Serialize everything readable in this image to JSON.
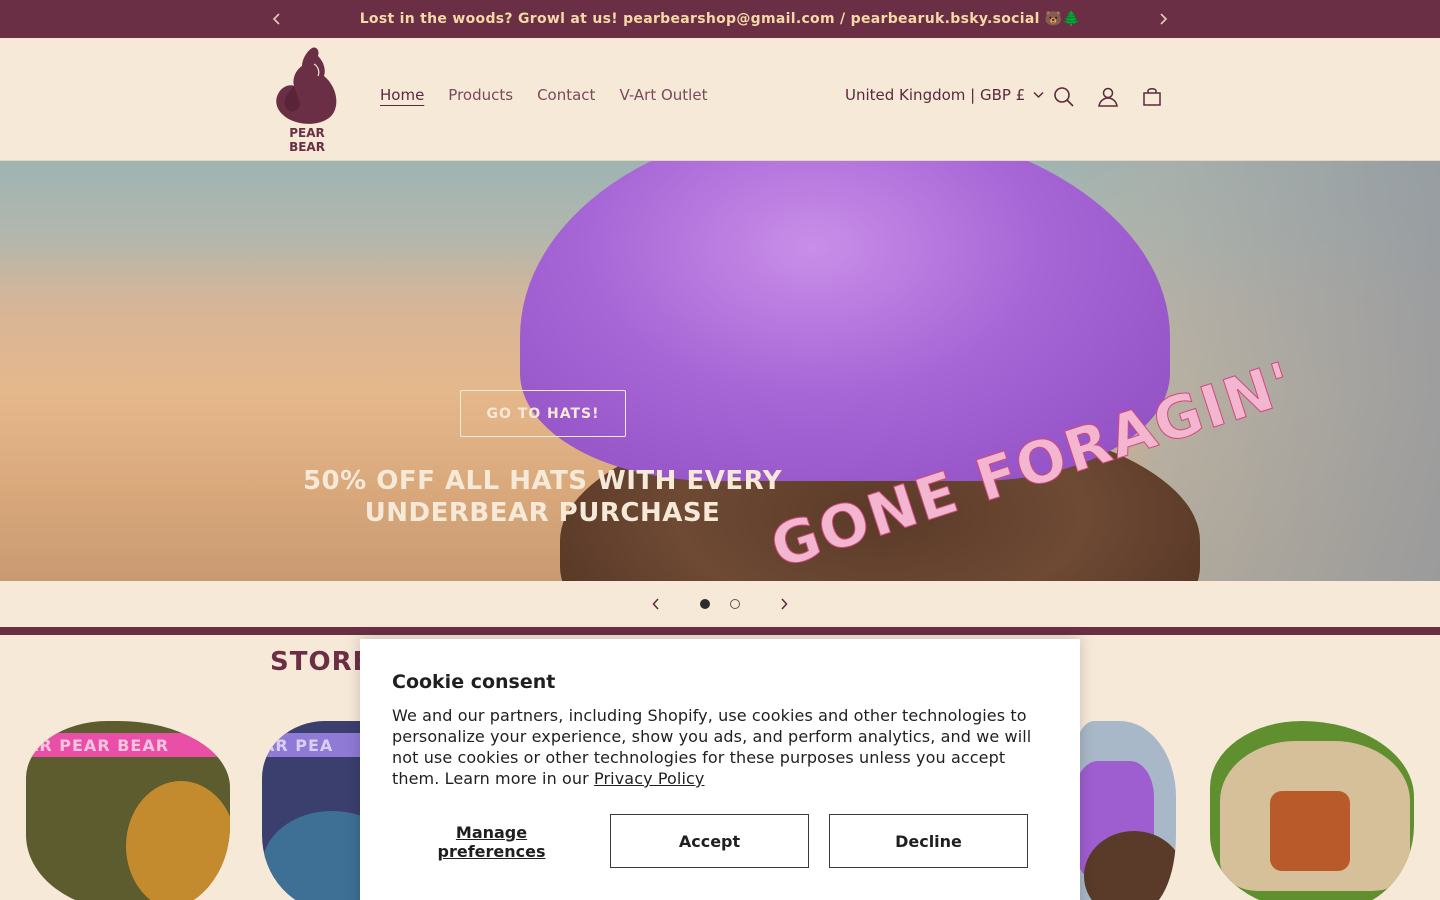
{
  "announcement": {
    "text": "Lost in the woods? Growl at us! pearbearshop@gmail.com / pearbearuk.bsky.social 🐻🌲",
    "prev_icon": "chevron-left",
    "next_icon": "chevron-right"
  },
  "header": {
    "logo_text_line1": "PEAR",
    "logo_text_line2": "BEAR",
    "nav": [
      {
        "label": "Home",
        "active": true
      },
      {
        "label": "Products",
        "active": false
      },
      {
        "label": "Contact",
        "active": false
      },
      {
        "label": "V-Art Outlet",
        "active": false
      }
    ],
    "country_selector": "United Kingdom | GBP £",
    "icons": [
      "search-icon",
      "account-icon",
      "cart-icon"
    ]
  },
  "hero": {
    "title_line1": "50% OFF ALL HATS WITH EVERY",
    "title_line2": "UNDERBEAR PURCHASE",
    "button": "GO TO HATS!",
    "embroidery": "GONE FORAGIN'"
  },
  "slideshow": {
    "current": 1,
    "total": 2
  },
  "store": {
    "title": "STORE",
    "band_text": "AR PEAR BEAR",
    "band_text2": "AR PEA"
  },
  "cookie": {
    "title": "Cookie consent",
    "body": "We and our partners, including Shopify, use cookies and other technologies to personalize your experience, show you ads, and perform analytics, and we will not use cookies or other technologies for these purposes unless you accept them. Learn more in our ",
    "link": "Privacy Policy",
    "manage_line1": "Manage",
    "manage_line2": "preferences",
    "accept": "Accept",
    "decline": "Decline"
  },
  "colors": {
    "brand": "#6b2f45",
    "background": "#f6e9d8",
    "announcement_text": "#f4d9a6"
  }
}
